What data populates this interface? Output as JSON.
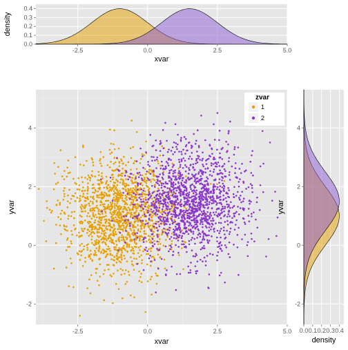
{
  "chart_data": [
    {
      "type": "density",
      "role": "top-marginal",
      "xlabel": "xvar",
      "ylabel": "density",
      "xlim": [
        -4,
        5
      ],
      "ylim": [
        0,
        0.45
      ],
      "xticks": [
        -2.5,
        0.0,
        2.5,
        5.0
      ],
      "yticks": [
        0.0,
        0.1,
        0.2,
        0.3,
        0.4
      ],
      "series": [
        {
          "name": "1",
          "color": "#e69f00",
          "mean": -1.0,
          "sd": 1.0
        },
        {
          "name": "2",
          "color": "#8a5bd1",
          "mean": 1.5,
          "sd": 1.0
        }
      ]
    },
    {
      "type": "scatter",
      "role": "main",
      "xlabel": "xvar",
      "ylabel": "yvar",
      "xlim": [
        -4,
        5
      ],
      "ylim": [
        -2.7,
        5.3
      ],
      "xticks": [
        -2.5,
        0.0,
        2.5,
        5.0
      ],
      "yticks": [
        -2,
        0,
        2,
        4
      ],
      "groups": [
        {
          "name": "1",
          "color": "#e69f00",
          "n": 1500,
          "mean_x": -1.0,
          "mean_y": 1.0,
          "sd_x": 1.0,
          "sd_y": 1.0
        },
        {
          "name": "2",
          "color": "#8a36c9",
          "n": 1500,
          "mean_x": 1.5,
          "mean_y": 1.5,
          "sd_x": 1.0,
          "sd_y": 1.0
        }
      ],
      "legend": {
        "title": "zvar",
        "items": [
          "1",
          "2"
        ],
        "position": "top-right-inside"
      }
    },
    {
      "type": "density",
      "role": "right-marginal",
      "xlabel": "density",
      "ylabel": "yvar",
      "xlim": [
        0,
        0.45
      ],
      "ylim": [
        -2.7,
        5.3
      ],
      "xticks": [
        0.0,
        0.1,
        0.2,
        0.3,
        0.4
      ],
      "yticks": [
        -2,
        0,
        2,
        4
      ],
      "series": [
        {
          "name": "1",
          "color": "#e69f00",
          "mean": 1.0,
          "sd": 1.0
        },
        {
          "name": "2",
          "color": "#8a5bd1",
          "mean": 1.5,
          "sd": 1.0
        }
      ]
    }
  ],
  "labels": {
    "xvar": "xvar",
    "yvar": "yvar",
    "density": "density",
    "legend_title": "zvar",
    "legend_1": "1",
    "legend_2": "2",
    "xt_m25": "-2.5",
    "xt_0": "0.0",
    "xt_25": "2.5",
    "xt_50": "5.0",
    "yt_m2": "-2",
    "yt_0": "0",
    "yt_2": "2",
    "yt_4": "4",
    "dt_00": "0.0",
    "dt_01": "0.1",
    "dt_02": "0.2",
    "dt_03": "0.3",
    "dt_04": "0.4"
  }
}
